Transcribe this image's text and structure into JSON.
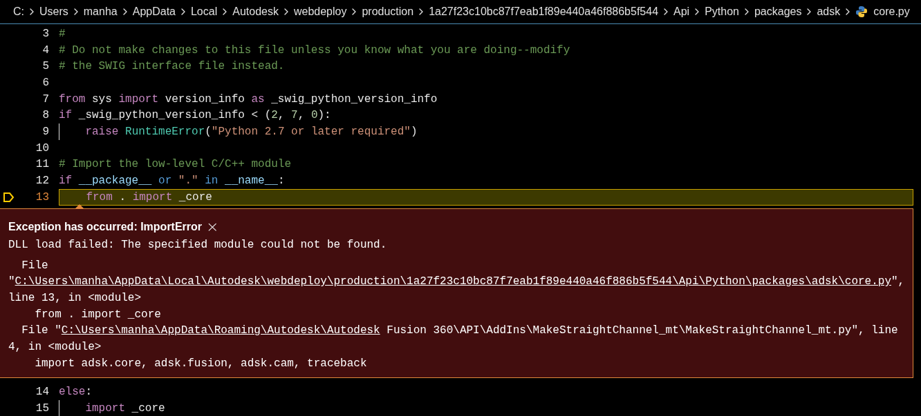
{
  "breadcrumb": [
    {
      "label": "C:",
      "kind": "folder"
    },
    {
      "label": "Users",
      "kind": "folder"
    },
    {
      "label": "manha",
      "kind": "folder"
    },
    {
      "label": "AppData",
      "kind": "folder"
    },
    {
      "label": "Local",
      "kind": "folder"
    },
    {
      "label": "Autodesk",
      "kind": "folder"
    },
    {
      "label": "webdeploy",
      "kind": "folder"
    },
    {
      "label": "production",
      "kind": "folder"
    },
    {
      "label": "1a27f23c10bc87f7eab1f89e440a46f886b5f544",
      "kind": "folder"
    },
    {
      "label": "Api",
      "kind": "folder"
    },
    {
      "label": "Python",
      "kind": "folder"
    },
    {
      "label": "packages",
      "kind": "folder"
    },
    {
      "label": "adsk",
      "kind": "folder"
    },
    {
      "label": "core.py",
      "kind": "python"
    }
  ],
  "lines_before": [
    {
      "number": "3",
      "current": false,
      "guide": false,
      "tokens": [
        {
          "text": "#",
          "kind": "comment"
        }
      ]
    },
    {
      "number": "4",
      "current": false,
      "guide": false,
      "tokens": [
        {
          "text": "# Do not make changes to this file unless you know what you are doing--modify",
          "kind": "comment"
        }
      ]
    },
    {
      "number": "5",
      "current": false,
      "guide": false,
      "tokens": [
        {
          "text": "# the SWIG interface file instead.",
          "kind": "comment"
        }
      ]
    },
    {
      "number": "6",
      "current": false,
      "guide": false
    },
    {
      "number": "7",
      "current": false,
      "guide": false,
      "tokens": [
        {
          "text": "from",
          "kind": "control"
        },
        {
          "text": " sys ",
          "kind": "plain"
        },
        {
          "text": "import",
          "kind": "control"
        },
        {
          "text": " version_info ",
          "kind": "plain"
        },
        {
          "text": "as",
          "kind": "control"
        },
        {
          "text": " _swig_python_version_info",
          "kind": "plain"
        }
      ]
    },
    {
      "number": "8",
      "current": false,
      "guide": false,
      "tokens": [
        {
          "text": "if",
          "kind": "control"
        },
        {
          "text": " _swig_python_version_info < (",
          "kind": "plain"
        },
        {
          "text": "2",
          "kind": "number"
        },
        {
          "text": ", ",
          "kind": "plain"
        },
        {
          "text": "7",
          "kind": "number"
        },
        {
          "text": ", ",
          "kind": "plain"
        },
        {
          "text": "0",
          "kind": "number"
        },
        {
          "text": "):",
          "kind": "plain"
        }
      ]
    },
    {
      "number": "9",
      "current": false,
      "guide": true,
      "tokens": [
        {
          "text": "    raise",
          "kind": "control"
        },
        {
          "text": " RuntimeError",
          "kind": "class"
        },
        {
          "text": "(",
          "kind": "plain"
        },
        {
          "text": "\"Python 2.7 or later required\"",
          "kind": "string"
        },
        {
          "text": ")",
          "kind": "plain"
        }
      ]
    },
    {
      "number": "10",
      "current": false,
      "guide": false
    },
    {
      "number": "11",
      "current": false,
      "guide": false,
      "tokens": [
        {
          "text": "# Import the low-level C/C++ module",
          "kind": "comment"
        }
      ]
    },
    {
      "number": "12",
      "current": false,
      "guide": false,
      "tokens": [
        {
          "text": "if",
          "kind": "control"
        },
        {
          "text": " __package__",
          "kind": "variable"
        },
        {
          "text": " or",
          "kind": "keyword"
        },
        {
          "text": " \".\"",
          "kind": "string"
        },
        {
          "text": " in",
          "kind": "keyword"
        },
        {
          "text": " __name__",
          "kind": "variable"
        },
        {
          "text": ":",
          "kind": "plain"
        }
      ]
    },
    {
      "number": "13",
      "current": true,
      "guide": false,
      "tokens": [
        {
          "text": "    from",
          "kind": "control"
        },
        {
          "text": " . ",
          "kind": "plain"
        },
        {
          "text": "import",
          "kind": "control"
        },
        {
          "text": " _core",
          "kind": "plain"
        }
      ]
    }
  ],
  "exception": {
    "title": "Exception has occurred: ImportError",
    "close": "×",
    "message": "DLL load failed: The specified module could not be found.",
    "traceback": [
      [
        {
          "text": "  File",
          "kind": "plain"
        }
      ],
      [
        {
          "text": "\"",
          "kind": "plain"
        },
        {
          "text": "C:\\Users\\manha\\AppData\\Local\\Autodesk\\webdeploy\\production\\1a27f23c10bc87f7eab1f89e440a46f886b5f544\\Api\\Python\\packages\\adsk\\core.py",
          "kind": "link"
        },
        {
          "text": "\",",
          "kind": "plain"
        }
      ],
      [
        {
          "text": "line 13, in <module>",
          "kind": "plain"
        }
      ],
      [
        {
          "text": "    from . import _core",
          "kind": "plain"
        }
      ],
      [
        {
          "text": "  File \"",
          "kind": "plain"
        },
        {
          "text": "C:\\Users\\manha\\AppData\\Roaming\\Autodesk\\Autodesk",
          "kind": "link"
        },
        {
          "text": " Fusion 360\\API\\AddIns\\MakeStraightChannel_mt\\MakeStraightChannel_mt.py\", line",
          "kind": "plain"
        }
      ],
      [
        {
          "text": "4, in <module>",
          "kind": "plain"
        }
      ],
      [
        {
          "text": "    import adsk.core, adsk.fusion, adsk.cam, traceback",
          "kind": "plain"
        }
      ]
    ]
  },
  "lines_after": [
    {
      "number": "14",
      "current": false,
      "guide": false,
      "tokens": [
        {
          "text": "else",
          "kind": "control"
        },
        {
          "text": ":",
          "kind": "plain"
        }
      ]
    },
    {
      "number": "15",
      "current": false,
      "guide": true,
      "tokens": [
        {
          "text": "    import",
          "kind": "control"
        },
        {
          "text": " _core",
          "kind": "plain"
        }
      ]
    }
  ]
}
